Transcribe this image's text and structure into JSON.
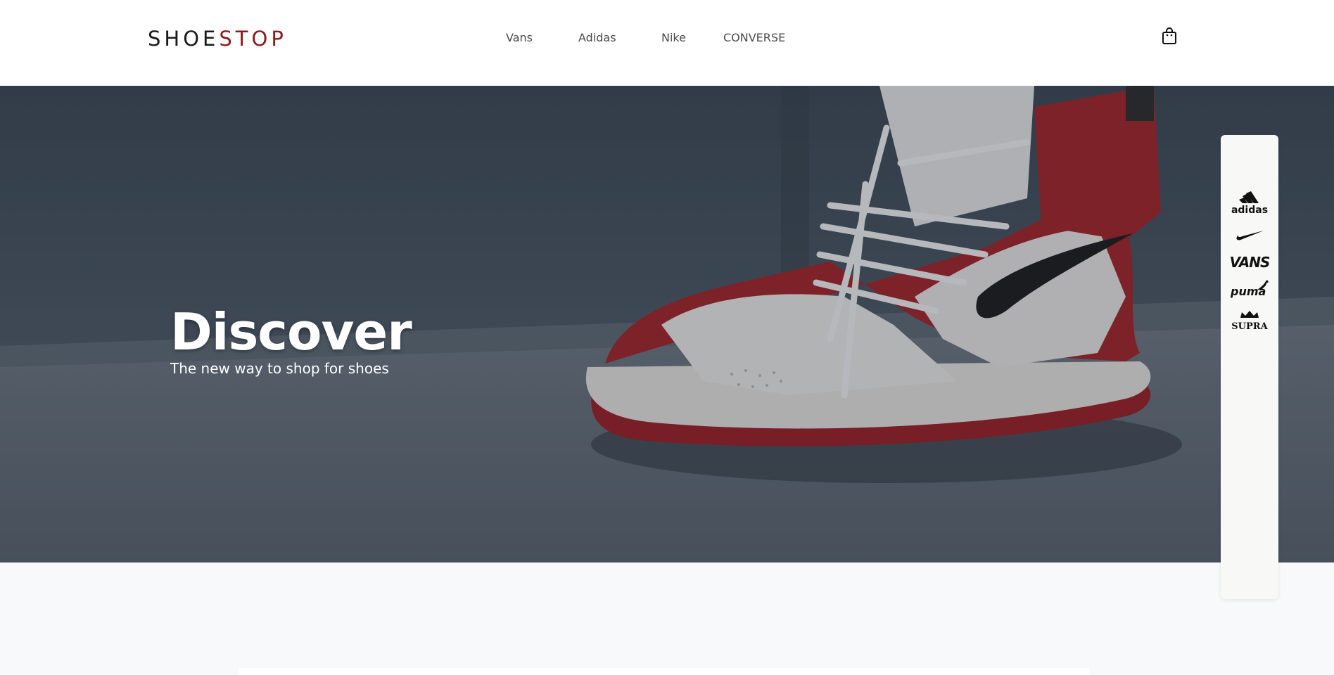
{
  "header": {
    "logo_part1": "SHOE",
    "logo_part2": "STOP",
    "nav": [
      "Vans",
      "Adidas",
      "Nike",
      "CONVERSE"
    ],
    "cart_icon": "shopping-bag-icon"
  },
  "hero": {
    "title": "Discover",
    "subtitle": "The new way to shop for shoes"
  },
  "brands": {
    "adidas": "adidas",
    "vans": "VANS",
    "puma": "puma",
    "supra": "SUPRA",
    "nike_icon": "nike-swoosh-icon"
  },
  "colors": {
    "logo_accent": "#8b1a1a",
    "text_dark": "#1a1a1a",
    "page_background": "#f8f9fa"
  }
}
